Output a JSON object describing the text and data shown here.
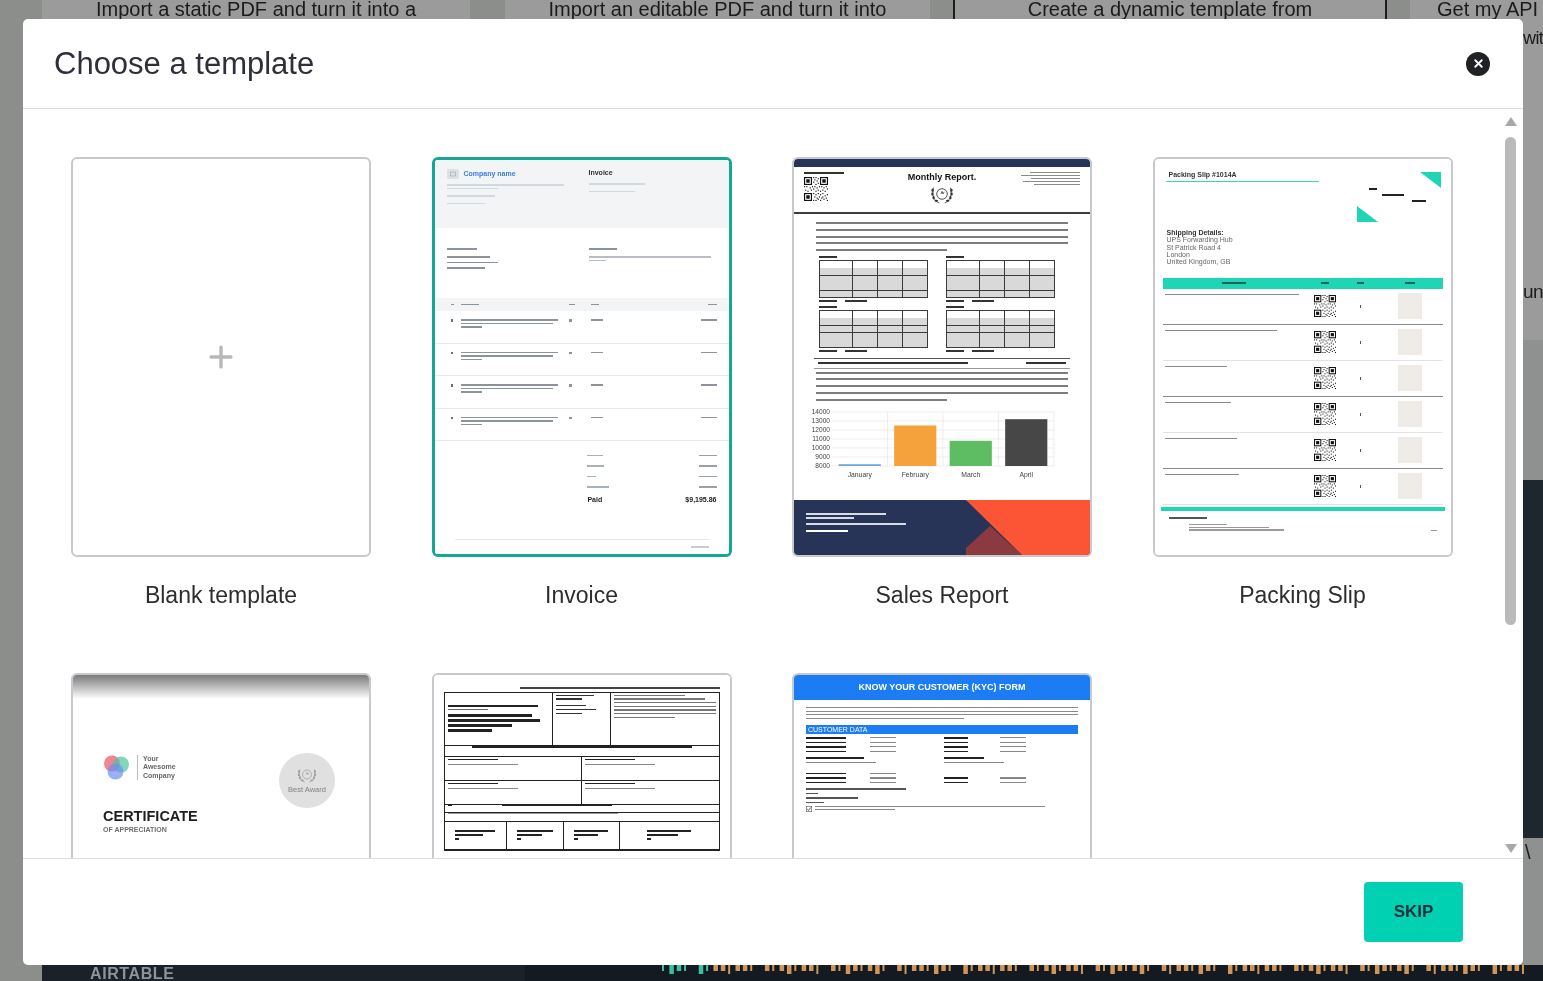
{
  "background": {
    "top_panels": [
      "Import a static PDF and turn it into a",
      "Import an editable PDF and turn it into",
      "Create a dynamic template from",
      "Get my API"
    ],
    "side_texts": [
      "wit",
      "un",
      "\\"
    ],
    "brand": "AIRTABLE"
  },
  "modal": {
    "title": "Choose a template",
    "action": "SKIP"
  },
  "templates": [
    {
      "kind": "blank",
      "label": "Blank template",
      "selected": false
    },
    {
      "kind": "invoice",
      "label": "Invoice",
      "selected": true,
      "preview": {
        "company": "Company name",
        "title": "Invoice",
        "paid_label": "Paid",
        "paid_amount": "$9,195.86"
      }
    },
    {
      "kind": "report",
      "label": "Sales Report",
      "selected": false,
      "preview": {
        "title": "Monthly Report.",
        "chart_data": {
          "type": "bar",
          "categories": [
            "January",
            "February",
            "March",
            "April"
          ],
          "values": [
            8200,
            12500,
            10800,
            13200
          ],
          "colors": [
            "#6fa8dc",
            "#f6a23c",
            "#5ebd63",
            "#474747"
          ],
          "ylim": [
            8000,
            14000
          ],
          "yticks": [
            8000,
            9000,
            10000,
            11000,
            12000,
            13000,
            14000
          ],
          "grid": true
        }
      }
    },
    {
      "kind": "packing_slip",
      "label": "Packing Slip",
      "selected": false,
      "preview": {
        "title": "Packing Slip #1014A",
        "shipping_heading": "Shipping Details:",
        "shipping_lines": [
          "UPS Forwarding Hub",
          "St Patrick Road 4",
          "London",
          "United Kingdom, GB"
        ]
      }
    },
    {
      "kind": "certificate",
      "selected": false,
      "preview": {
        "company": "Your Awesome Company",
        "seal": "Best Award",
        "title": "CERTIFICATE",
        "subtitle": "OF APPRECIATION"
      }
    },
    {
      "kind": "fda_form",
      "selected": false
    },
    {
      "kind": "kyc_form",
      "selected": false,
      "preview": {
        "title": "KNOW YOUR CUSTOMER (KYC) FORM",
        "section": "CUSTOMER DATA",
        "consent_checked": true
      }
    }
  ]
}
